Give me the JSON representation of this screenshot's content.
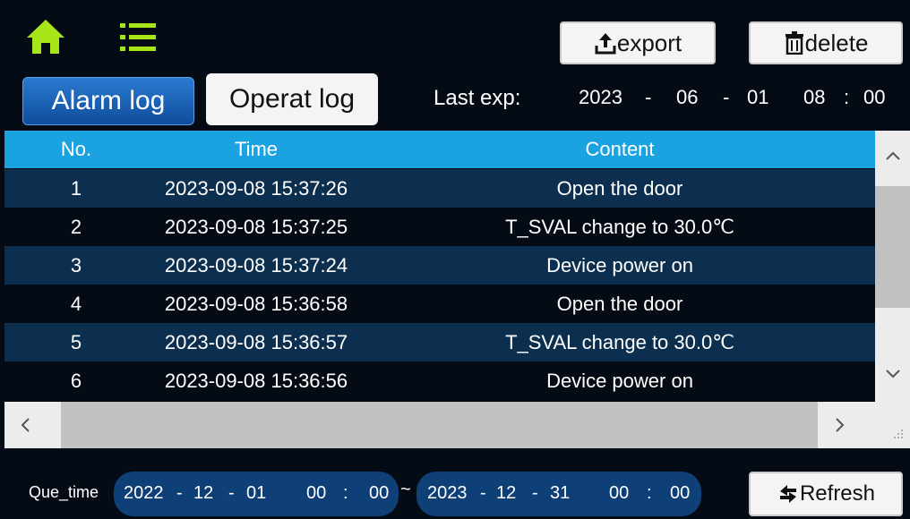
{
  "toolbar": {
    "export_label": "export",
    "delete_label": "delete",
    "export_icon": "upload-icon",
    "delete_icon": "trash-icon"
  },
  "tabs": {
    "alarm": "Alarm log",
    "operat": "Operat log",
    "active": "alarm"
  },
  "last_export": {
    "label": "Last exp:",
    "year": "2023",
    "month": "06",
    "day": "01",
    "hour": "08",
    "minute": "00",
    "sep_date": "-",
    "sep_time": ":"
  },
  "table": {
    "headers": [
      "No.",
      "Time",
      "Content"
    ],
    "rows": [
      {
        "no": "1",
        "time": "2023-09-08 15:37:26",
        "content": "Open the door"
      },
      {
        "no": "2",
        "time": "2023-09-08 15:37:25",
        "content": "T_SVAL change to 30.0℃"
      },
      {
        "no": "3",
        "time": "2023-09-08 15:37:24",
        "content": "Device power on"
      },
      {
        "no": "4",
        "time": "2023-09-08 15:36:58",
        "content": "Open the door"
      },
      {
        "no": "5",
        "time": "2023-09-08 15:36:57",
        "content": "T_SVAL change to 30.0℃"
      },
      {
        "no": "6",
        "time": "2023-09-08 15:36:56",
        "content": "Device power on"
      }
    ]
  },
  "query": {
    "label": "Que_time",
    "start": {
      "year": "2022",
      "month": "12",
      "day": "01",
      "hour": "00",
      "minute": "00"
    },
    "end": {
      "year": "2023",
      "month": "12",
      "day": "31",
      "hour": "00",
      "minute": "00"
    },
    "date_sep": "-",
    "time_sep": ":",
    "range_sep": "~"
  },
  "refresh_label": "Refresh",
  "colors": {
    "background": "#050b14",
    "header": "#1aa3e0",
    "row_odd": "#0c2f4f",
    "active_tab": "#1a63b8",
    "home_icon": "#a6e619"
  }
}
